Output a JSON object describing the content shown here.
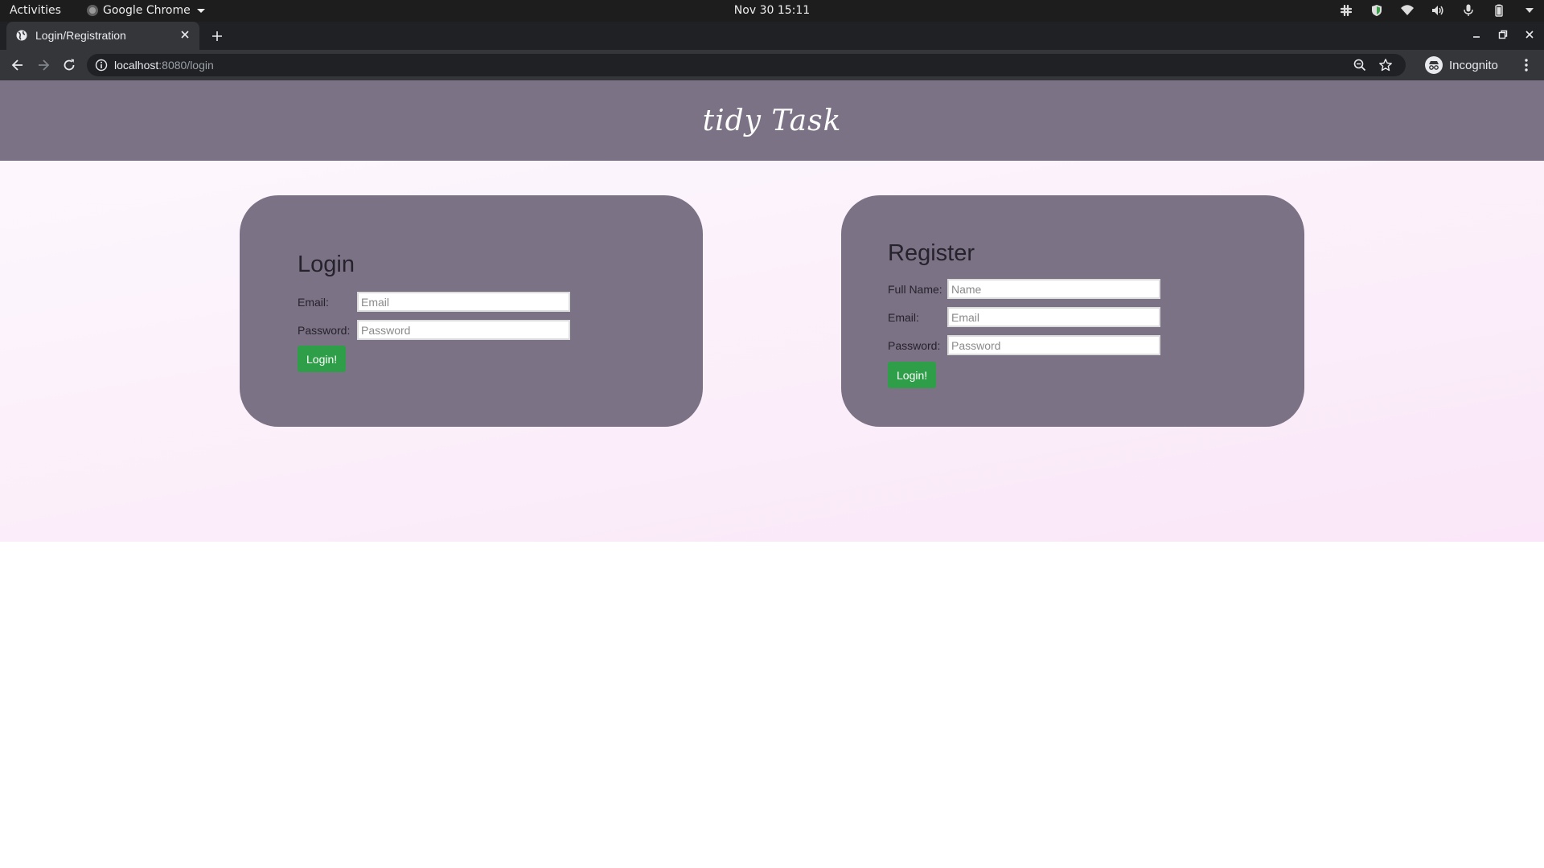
{
  "system_bar": {
    "activities": "Activities",
    "app_menu": "Google Chrome",
    "clock": "Nov 30  15:11"
  },
  "browser": {
    "tab_title": "Login/Registration",
    "url_host": "localhost",
    "url_path": ":8080/login",
    "profile_label": "Incognito"
  },
  "site": {
    "title": "tidy Task"
  },
  "login": {
    "heading": "Login",
    "email_label": "Email:",
    "email_placeholder": "Email",
    "password_label": "Password:",
    "password_placeholder": "Password",
    "submit_label": "Login!"
  },
  "register": {
    "heading": "Register",
    "name_label": "Full Name:",
    "name_placeholder": "Name",
    "email_label": "Email:",
    "email_placeholder": "Email",
    "password_label": "Password:",
    "password_placeholder": "Password",
    "submit_label": "Login!"
  },
  "colors": {
    "header_bg": "#7b7285",
    "card_bg": "#7b7285",
    "button_green": "#2e9e48",
    "page_gradient_start": "#fdf7fd",
    "page_gradient_end": "#fae6f8"
  }
}
